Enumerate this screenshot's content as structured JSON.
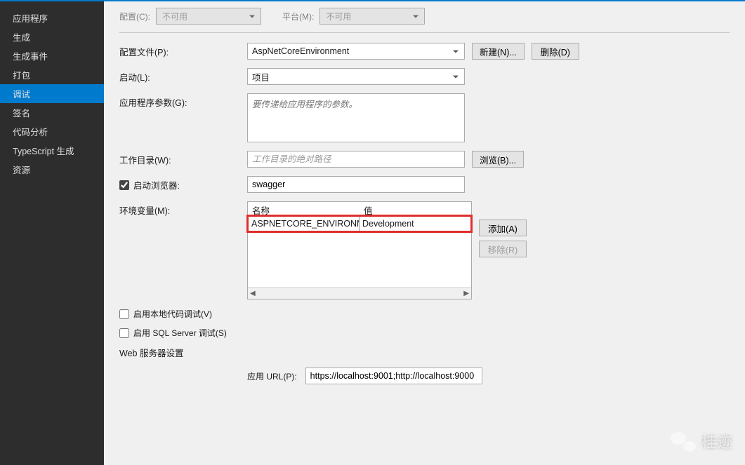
{
  "sidebar": {
    "items": [
      {
        "label": "应用程序"
      },
      {
        "label": "生成"
      },
      {
        "label": "生成事件"
      },
      {
        "label": "打包"
      },
      {
        "label": "调试",
        "active": true
      },
      {
        "label": "签名"
      },
      {
        "label": "代码分析"
      },
      {
        "label": "TypeScript 生成"
      },
      {
        "label": "资源"
      }
    ]
  },
  "header": {
    "config_label": "配置(C):",
    "config_value": "不可用",
    "platform_label": "平台(M):",
    "platform_value": "不可用"
  },
  "form": {
    "profile_label": "配置文件(P):",
    "profile_value": "AspNetCoreEnvironment",
    "new_btn": "新建(N)...",
    "delete_btn": "删除(D)",
    "launch_label": "启动(L):",
    "launch_value": "项目",
    "args_label": "应用程序参数(G):",
    "args_placeholder": "要传递给应用程序的参数。",
    "workdir_label": "工作目录(W):",
    "workdir_placeholder": "工作目录的绝对路径",
    "browse_btn": "浏览(B)...",
    "launch_browser_label": "启动浏览器:",
    "launch_browser_value": "swagger",
    "env_label": "环境变量(M):",
    "env_header_name": "名称",
    "env_header_value": "值",
    "env_row_name": "ASPNETCORE_ENVIRONMENT",
    "env_row_value": "Development",
    "add_btn": "添加(A)",
    "remove_btn": "移除(R)",
    "native_debug_label": "启用本地代码调试(V)",
    "sqlserver_debug_label": "启用 SQL Server 调试(S)",
    "webserver_section": "Web 服务器设置",
    "app_url_label": "应用 URL(P):",
    "app_url_value": "https://localhost:9001;http://localhost:9000"
  },
  "watermark": {
    "text": "桂迹"
  }
}
